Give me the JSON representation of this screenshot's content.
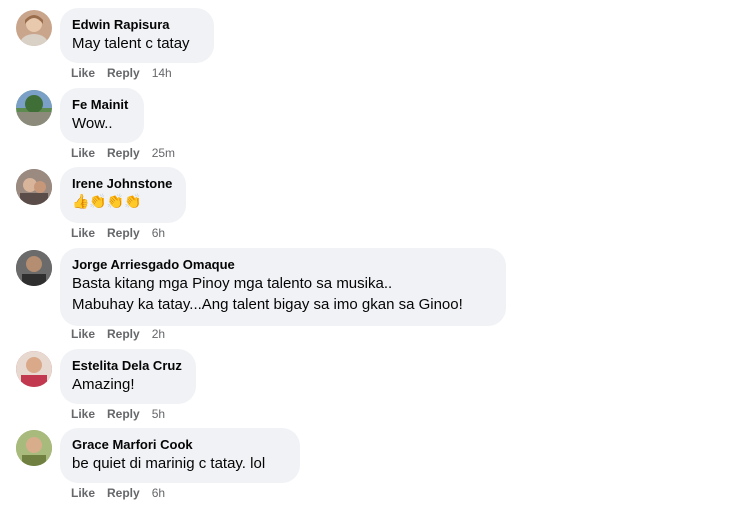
{
  "comments": [
    {
      "author": "Edwin Rapisura",
      "lines": [
        "May talent c tatay"
      ],
      "like": "Like",
      "reply": "Reply",
      "time": "14h",
      "avatar_color": "#c9a58c"
    },
    {
      "author": "Fe Mainit",
      "lines": [
        "Wow.."
      ],
      "like": "Like",
      "reply": "Reply",
      "time": "25m",
      "avatar_color": "#5d8a4e"
    },
    {
      "author": "Irene Johnstone",
      "lines": [
        "👍👏👏👏"
      ],
      "like": "Like",
      "reply": "Reply",
      "time": "6h",
      "avatar_color": "#7b6a66"
    },
    {
      "author": "Jorge Arriesgado Omaque",
      "lines": [
        "Basta kitang mga Pinoy mga talento sa musika..",
        "Mabuhay ka tatay...Ang talent bigay sa imo gkan sa Ginoo!"
      ],
      "like": "Like",
      "reply": "Reply",
      "time": "2h",
      "avatar_color": "#4a4a4a"
    },
    {
      "author": "Estelita Dela Cruz",
      "lines": [
        "Amazing!"
      ],
      "like": "Like",
      "reply": "Reply",
      "time": "5h",
      "avatar_color": "#c06070"
    },
    {
      "author": "Grace Marfori Cook",
      "lines": [
        "be quiet di marinig c tatay. lol"
      ],
      "like": "Like",
      "reply": "Reply",
      "time": "6h",
      "avatar_color": "#8aa060"
    }
  ]
}
